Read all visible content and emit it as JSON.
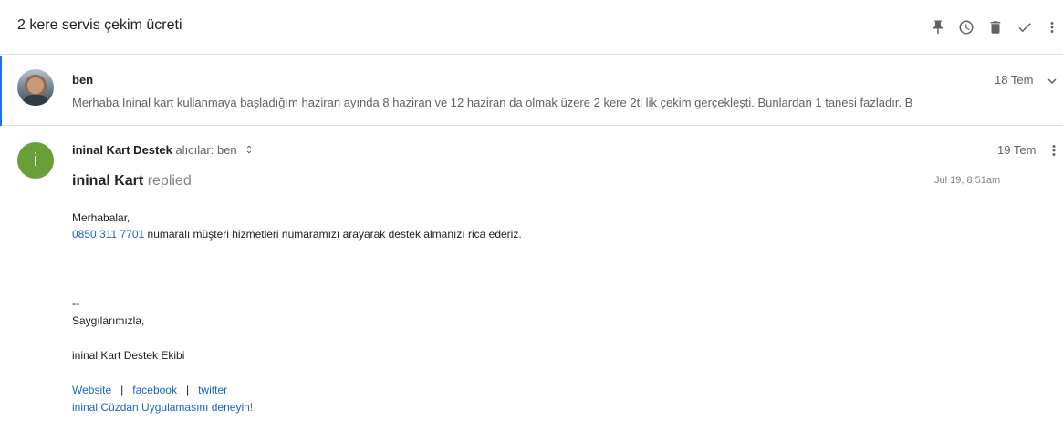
{
  "thread": {
    "subject": "2 kere servis çekim ücreti",
    "toolbar": [
      {
        "icon": "pin-icon"
      },
      {
        "icon": "clock-icon"
      },
      {
        "icon": "trash-icon"
      },
      {
        "icon": "check-icon"
      },
      {
        "icon": "more-vert-icon"
      }
    ]
  },
  "message1": {
    "sender": "ben",
    "date": "18 Tem",
    "snippet": "Merhaba İninal kart kullanmaya başladığım haziran ayında 8 haziran ve 12 haziran da olmak üzere 2 kere 2tl lik çekim gerçekleşti. Bunlardan 1 tanesi fazladır. B"
  },
  "message2": {
    "avatar_letter": "i",
    "avatar_color": "#689f38",
    "sender": "ininal Kart Destek",
    "recipients": "alıcılar: ben",
    "date": "19 Tem",
    "replied_name": "ininal Kart",
    "replied_word": "replied",
    "replied_time": "Jul 19, 8:51am",
    "greeting": "Merhabalar,",
    "phone": "0850 311 7701",
    "body_rest": " numaralı müşteri hizmetleri numaramızı arayarak destek almanızı rica ederiz.",
    "sig_dash": "--",
    "sig_closing": "Saygılarımızla,",
    "sig_team": "ininal Kart Destek Ekibi",
    "links": {
      "website": "Website",
      "facebook": "facebook",
      "twitter": "twitter",
      "separator": "|"
    },
    "app_promo": "ininal Cüzdan Uygulamasını deneyin!"
  },
  "colors": {
    "accent": "#1a73e8",
    "link": "#1a66c6"
  }
}
